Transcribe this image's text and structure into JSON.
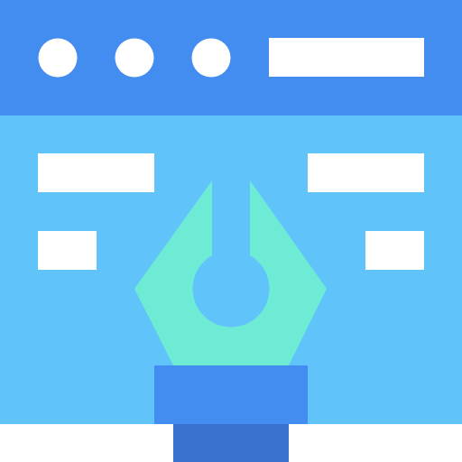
{
  "icon": {
    "name": "web-design-pen-icon",
    "colors": {
      "title_bar": "#448DF0",
      "window_body": "#60C3FA",
      "window_dots": "#FFFFFF",
      "text_bars": "#FFFFFF",
      "pen_nib": "#6EEBD5",
      "pen_slit_and_hole": "#60C3FA",
      "pen_collar": "#448DF0",
      "pen_grip": "#3A73CF",
      "background": "#FFFFFF"
    }
  }
}
